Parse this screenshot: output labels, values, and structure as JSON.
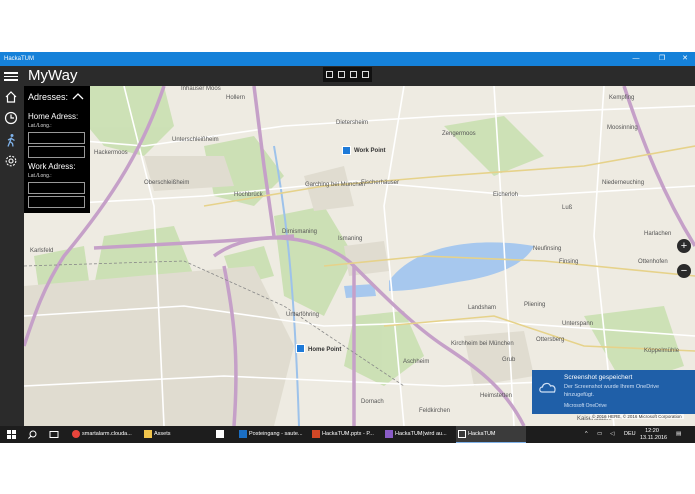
{
  "window": {
    "title": "HackaTUM",
    "controls": [
      "minimize",
      "restore",
      "close"
    ]
  },
  "app": {
    "title": "MyWay"
  },
  "nav": {
    "items": [
      "home-icon",
      "clock-icon",
      "walk-icon",
      "settings-icon"
    ]
  },
  "panel": {
    "header": "Adresses:",
    "home_label": "Home Adress:",
    "home_sub": "Lat./Long.:",
    "work_label": "Work Adress:",
    "work_sub": "Lat./Long.:"
  },
  "map": {
    "places": {
      "inhauser_moos": "Inhauser Moos",
      "hollern": "Hollern",
      "kempfing": "Kempfing",
      "unterschleissheim": "Unterschleißheim",
      "hackermoos": "Hackermoos",
      "dietersheim": "Dietersheim",
      "zengermoos": "Zengermoos",
      "oberschleissheim": "Oberschleißheim",
      "garching": "Garching bei München",
      "fischerhaeuser": "Fischerhäuser",
      "eicherloh": "Eicherloh",
      "niederneuching": "Niederneuching",
      "hochbrueck": "Hochbrück",
      "moosinning": "Moosinning",
      "luss": "Luß",
      "karlsfeld": "Karlsfeld",
      "dirnismaning": "Dirnismaning",
      "ismaning": "Ismaning",
      "neufinsing": "Neufinsing",
      "finsing": "Finsing",
      "ottenhofen": "Ottenhofen",
      "harlachen": "Harlachen",
      "unterfoehring": "Unterföhring",
      "landsham": "Landsham",
      "pliening": "Pliening",
      "kirchheim": "Kirchheim bei München",
      "unterspann": "Unterspann",
      "aschheim": "Aschheim",
      "grub": "Grub",
      "ottersberg": "Ottersberg",
      "dornach": "Dornach",
      "feldkirchen": "Feldkirchen",
      "heimstetten": "Heimstetten",
      "koeppelmuehle": "Köppelmühle",
      "kaiserslautern": "Kaiserslaut..."
    },
    "work_point": "Work Point",
    "home_point": "Home Point",
    "zoom_in": "+",
    "zoom_out": "−",
    "copyright": "© 2016 HERE, © 2016 Microsoft Corporation"
  },
  "toast": {
    "title": "Screenshot gespeichert",
    "body": "Der Screenshot wurde Ihrem OneDrive hinzugefügt.",
    "source": "Microsoft OneDrive"
  },
  "taskbar": {
    "items": [
      {
        "label": "smartalarm.clouda...",
        "icon": "chrome-icon"
      },
      {
        "label": "Assets",
        "icon": "folder-icon"
      },
      {
        "label": "",
        "icon": "store-icon"
      },
      {
        "label": "Posteingang - saute...",
        "icon": "outlook-icon"
      },
      {
        "label": "HackaTUM.pptx - P...",
        "icon": "powerpoint-icon"
      },
      {
        "label": "HackaTUM(wird au...",
        "icon": "visual-studio-icon"
      },
      {
        "label": "HackaTUM",
        "icon": "app-icon"
      }
    ],
    "lang": "DEU",
    "time": "12:20",
    "date": "13.11.2016"
  },
  "colors": {
    "accent": "#1581d9",
    "chrome": "#2b2b2b",
    "toast": "#1f5fa8",
    "pin": "#1e7ad8"
  }
}
